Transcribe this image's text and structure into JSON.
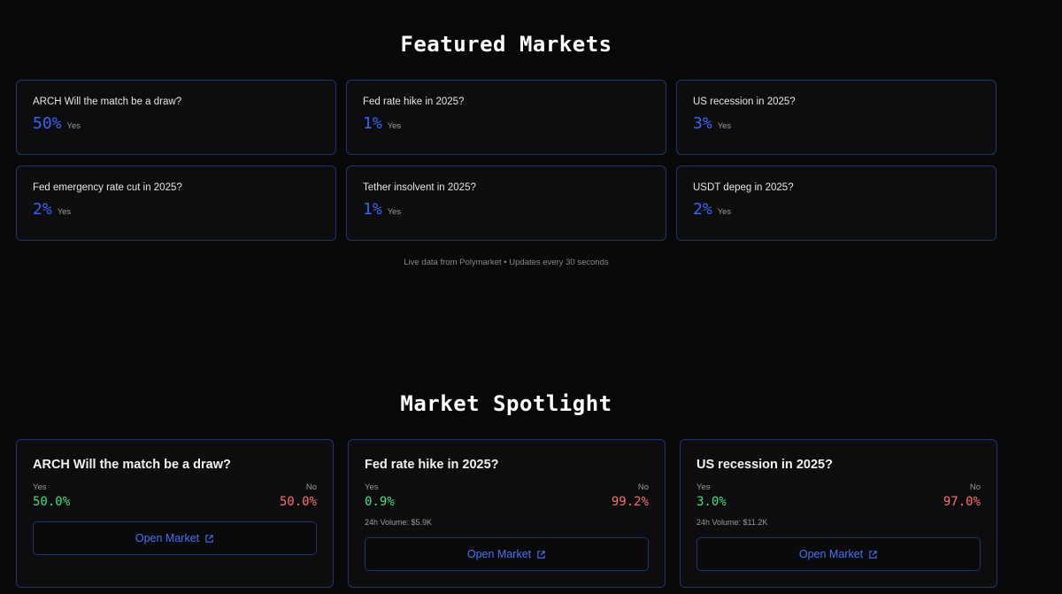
{
  "featured": {
    "title": "Featured Markets",
    "markets": [
      {
        "question": "ARCH Will the match be a draw?",
        "pct": "50%",
        "side": "Yes"
      },
      {
        "question": "Fed rate hike in 2025?",
        "pct": "1%",
        "side": "Yes"
      },
      {
        "question": "US recession in 2025?",
        "pct": "3%",
        "side": "Yes"
      },
      {
        "question": "Fed emergency rate cut in 2025?",
        "pct": "2%",
        "side": "Yes"
      },
      {
        "question": "Tether insolvent in 2025?",
        "pct": "1%",
        "side": "Yes"
      },
      {
        "question": "USDT depeg in 2025?",
        "pct": "2%",
        "side": "Yes"
      }
    ],
    "footnote": "Live data from Polymarket • Updates every 30 seconds"
  },
  "spotlight": {
    "title": "Market Spotlight",
    "cards": [
      {
        "question": "ARCH Will the match be a draw?",
        "yes_label": "Yes",
        "no_label": "No",
        "yes_value": "50.0%",
        "no_value": "50.0%",
        "volume": "",
        "button_label": "Open Market"
      },
      {
        "question": "Fed rate hike in 2025?",
        "yes_label": "Yes",
        "no_label": "No",
        "yes_value": "0.9%",
        "no_value": "99.2%",
        "volume": "24h Volume: $5.9K",
        "button_label": "Open Market"
      },
      {
        "question": "US recession in 2025?",
        "yes_label": "Yes",
        "no_label": "No",
        "yes_value": "3.0%",
        "no_value": "97.0%",
        "volume": "24h Volume: $11.2K",
        "button_label": "Open Market"
      }
    ]
  },
  "colors": {
    "background": "#080808",
    "card_border": "#1f3470",
    "accent_blue": "#3b63f0",
    "yes_green": "#4ade80",
    "no_red": "#f87171"
  },
  "icons": {
    "button_icon": "external-link-icon"
  }
}
